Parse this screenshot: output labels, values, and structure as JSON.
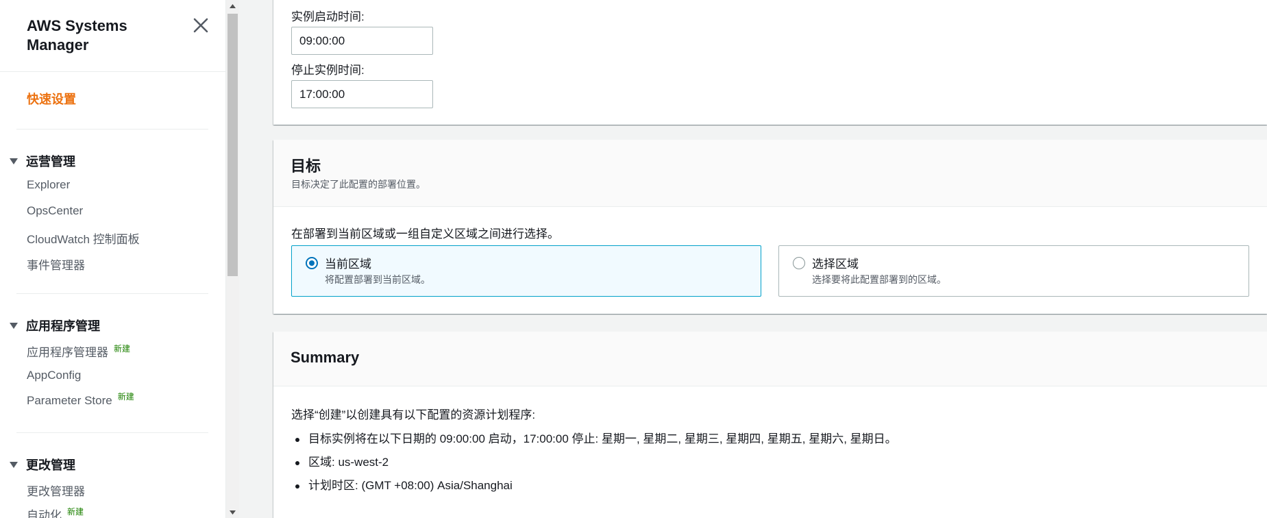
{
  "sidebar": {
    "title": "AWS Systems Manager",
    "quick_setup": "快速设置",
    "sections": [
      {
        "label": "运营管理",
        "items": [
          {
            "label": "Explorer",
            "badge": ""
          },
          {
            "label": "OpsCenter",
            "badge": ""
          },
          {
            "label": "CloudWatch 控制面板",
            "badge": ""
          },
          {
            "label": "事件管理器",
            "badge": ""
          }
        ]
      },
      {
        "label": "应用程序管理",
        "items": [
          {
            "label": "应用程序管理器",
            "badge": "新建"
          },
          {
            "label": "AppConfig",
            "badge": ""
          },
          {
            "label": "Parameter Store",
            "badge": "新建"
          }
        ]
      },
      {
        "label": "更改管理",
        "items": [
          {
            "label": "更改管理器",
            "badge": ""
          },
          {
            "label": "自动化",
            "badge": "新建"
          }
        ]
      }
    ]
  },
  "schedule": {
    "start_label": "实例启动时间:",
    "start_value": "09:00:00",
    "stop_label": "停止实例时间:",
    "stop_value": "17:00:00"
  },
  "targets": {
    "title": "目标",
    "description": "目标决定了此配置的部署位置。",
    "prompt": "在部署到当前区域或一组自定义区域之间进行选择。",
    "options": [
      {
        "label": "当前区域",
        "description": "将配置部署到当前区域。",
        "selected": true
      },
      {
        "label": "选择区域",
        "description": "选择要将此配置部署到的区域。",
        "selected": false
      }
    ]
  },
  "summary": {
    "title": "Summary",
    "intro": "选择“创建”以创建具有以下配置的资源计划程序:",
    "items": [
      "目标实例将在以下日期的 09:00:00 启动，17:00:00 停止: 星期一, 星期二, 星期三, 星期四, 星期五, 星期六, 星期日。",
      "区域: us-west-2",
      "计划时区: (GMT +08:00) Asia/Shanghai"
    ]
  },
  "colors": {
    "accent": "#ec7211",
    "new_badge": "#1d8102",
    "selected_border": "#00a1c9",
    "radio": "#0073bb"
  }
}
